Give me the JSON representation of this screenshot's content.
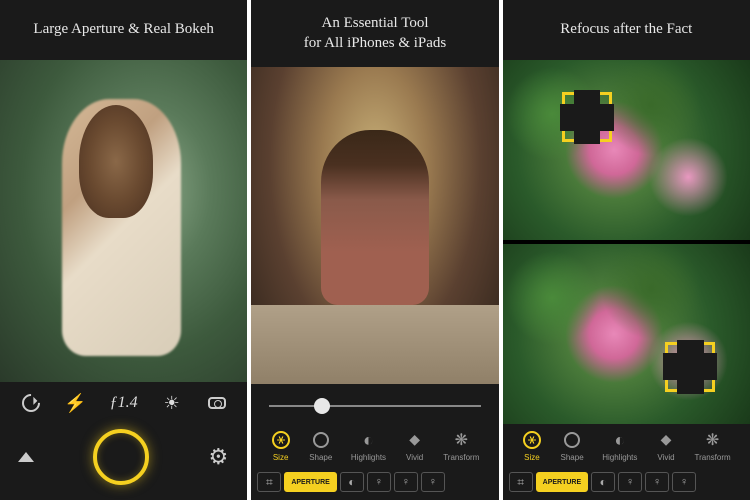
{
  "panels": [
    {
      "title": "Large Aperture & Real Bokeh",
      "controls": {
        "f_number": "ƒ1.4"
      }
    },
    {
      "title": "An Essential Tool\nfor All iPhones & iPads",
      "tools": [
        {
          "label": "Size",
          "active": true
        },
        {
          "label": "Shape",
          "active": false
        },
        {
          "label": "Highlights",
          "active": false
        },
        {
          "label": "Vivid",
          "active": false
        },
        {
          "label": "Transform",
          "active": false
        }
      ],
      "tabs": {
        "active_label": "APERTURE"
      }
    },
    {
      "title": "Refocus after the Fact",
      "tools": [
        {
          "label": "Size",
          "active": true
        },
        {
          "label": "Shape",
          "active": false
        },
        {
          "label": "Highlights",
          "active": false
        },
        {
          "label": "Vivid",
          "active": false
        },
        {
          "label": "Transform",
          "active": false
        }
      ],
      "tabs": {
        "active_label": "APERTURE"
      }
    }
  ],
  "colors": {
    "accent": "#f5d020",
    "bg": "#1a1a1a"
  }
}
